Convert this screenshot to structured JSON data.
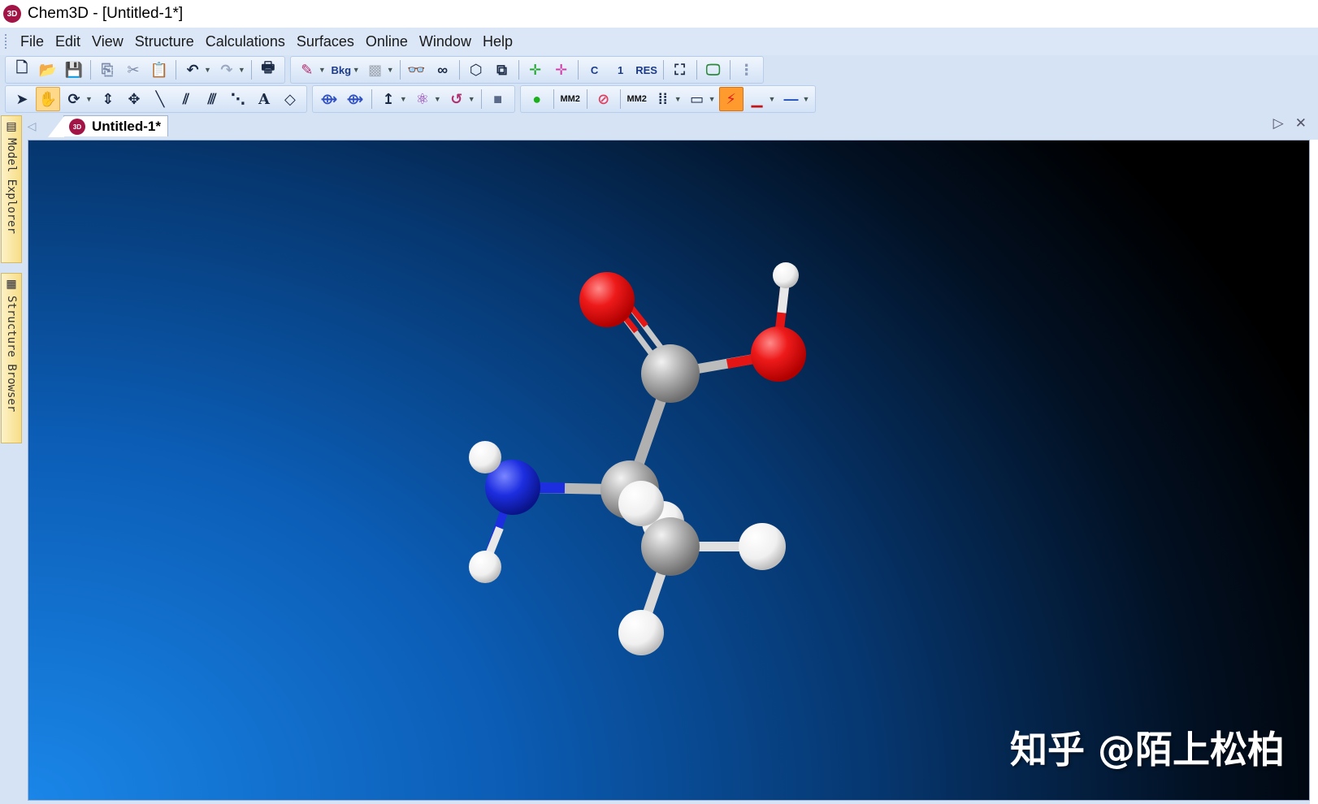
{
  "window": {
    "title": "Chem3D - [Untitled-1*]",
    "app_icon_text": "3D",
    "icon": "chem3d-app-icon"
  },
  "menu": [
    "File",
    "Edit",
    "View",
    "Structure",
    "Calculations",
    "Surfaces",
    "Online",
    "Window",
    "Help"
  ],
  "toolbar1": {
    "bkg_label": "Bkg",
    "c_label": "C",
    "one_label": "1",
    "res_label": "RES"
  },
  "toolbar2": {
    "text_tool_label": "A",
    "mm2_label_a": "MM2",
    "mm2_label_b": "MM2"
  },
  "side_panels": {
    "model_explorer": "Model Explorer",
    "structure_browser": "Structure Browser"
  },
  "document": {
    "tab_label": "Untitled-1*",
    "tab_icon_text": "3D"
  },
  "canvas": {
    "molecule": "alanine (ball and stick)",
    "watermark": "知乎 @陌上松柏",
    "atom_colors": {
      "carbon": "#9a9a9a",
      "oxygen": "#e31515",
      "nitrogen": "#1524d8",
      "hydrogen": "#f0f0f0"
    }
  },
  "colors": {
    "accent_active_tool": "#ffd88a",
    "orange_tool": "#ff9a2e"
  }
}
